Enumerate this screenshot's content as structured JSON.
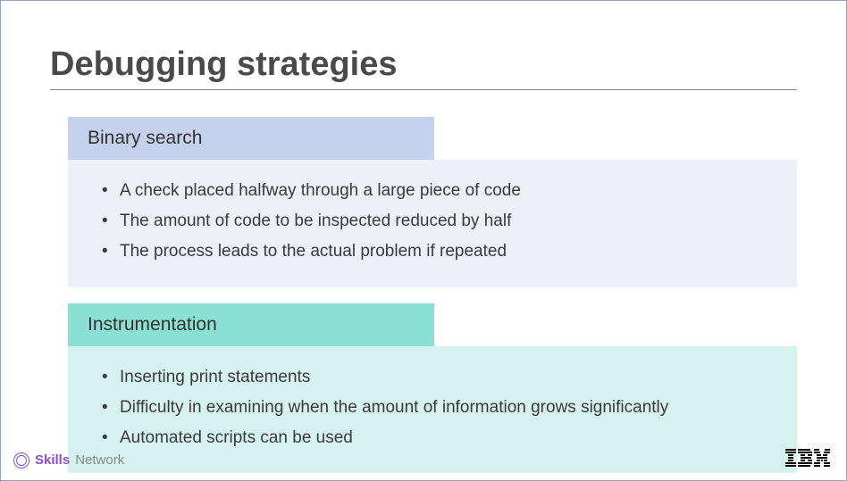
{
  "title": "Debugging strategies",
  "sections": [
    {
      "heading": "Binary search",
      "items": [
        "A check placed halfway through a large piece of code",
        "The amount of code to be inspected reduced by half",
        "The process leads to the actual problem if repeated"
      ]
    },
    {
      "heading": "Instrumentation",
      "items": [
        "Inserting print statements",
        "Difficulty in examining when the amount of information grows significantly",
        "Automated scripts can be used"
      ]
    }
  ],
  "footer": {
    "skills": "Skills",
    "network": "Network",
    "logo": "IBM"
  }
}
